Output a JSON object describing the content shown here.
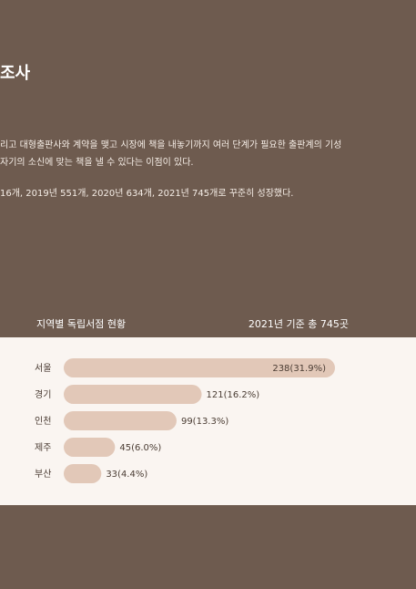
{
  "heading": "조사",
  "paragraphs": [
    "리고 대형출판사와 계약을 맺고 시장에 책을 내놓기까지 여러 단계가 필요한 출판계의 기성",
    " 자기의 소신에 맞는 책을 낼 수 있다는 이점이 있다.",
    "16개, 2019년 551개, 2020년 634개, 2021년 745개로 꾸준히 성장했다."
  ],
  "chart_header": {
    "left": "지역별 독립서점 현황",
    "right": "2021년  기준  총 745곳"
  },
  "colors": {
    "background": "#6e5b4f",
    "panel": "#faf5f1",
    "bar": "#e2c8b8",
    "text_dark": "#4a3c33"
  },
  "chart_data": {
    "type": "bar",
    "orientation": "horizontal",
    "categories": [
      "서울",
      "경기",
      "인천",
      "제주",
      "부산"
    ],
    "values": [
      238,
      121,
      99,
      45,
      33
    ],
    "labels": [
      "238(31.9%)",
      "121(16.2%)",
      "99(13.3%)",
      "45(6.0%)",
      "33(4.4%)"
    ],
    "title": "지역별 독립서점 현황",
    "xlim": [
      0,
      238
    ],
    "grid": false
  }
}
